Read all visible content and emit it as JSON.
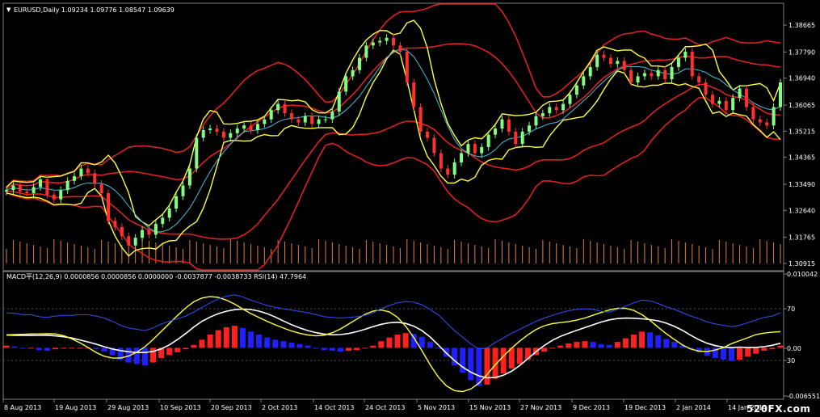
{
  "window": {
    "title": "EURUSD,Daily",
    "ohlc": "1.09234 1.09776 1.08547 1.09639"
  },
  "indicator_label": "MACD平(12,26,9) 0.0000856 0.0000856 0.0000000 -0.0037877 -0.0038733  RSI(14) 47.7964",
  "price_axis": [
    "1.38665",
    "1.37790",
    "1.36940",
    "1.36065",
    "1.35215",
    "1.34365",
    "1.33490",
    "1.32640",
    "1.31765",
    "1.30915"
  ],
  "indicator_axis": [
    "0.010042",
    "70",
    "0.00",
    "30",
    "-0.006551"
  ],
  "date_axis": [
    "8 Aug 2013",
    "19 Aug 2013",
    "29 Aug 2013",
    "10 Sep 2013",
    "20 Sep 2013",
    "2 Oct 2013",
    "14 Oct 2013",
    "24 Oct 2013",
    "5 Nov 2013",
    "15 Nov 2013",
    "27 Nov 2013",
    "9 Dec 2013",
    "19 Dec 2013",
    "2 Jan 2014",
    "14 Jan 2014"
  ],
  "watermark": "520FX.com",
  "colors": {
    "background": "#000000",
    "grid": "#3a3a3a",
    "bollinger": "#e02020",
    "envelope": "#ffff40",
    "moving_average": "#40c0e0",
    "candle_bull": "#80ff80",
    "candle_bear": "#ff3030",
    "volume": "#e08040",
    "macd_up": "#ff2020",
    "macd_down": "#2020ff",
    "rsi": "#3050ff",
    "signal_white": "#ffffff",
    "signal_yellow": "#ffff40"
  },
  "chart_data": [
    {
      "type": "candlestick",
      "title": "EURUSD,Daily",
      "ylim": [
        1.3067,
        1.391
      ],
      "close": [
        1.333,
        1.3345,
        1.3325,
        1.332,
        1.334,
        1.3365,
        1.3315,
        1.33,
        1.333,
        1.336,
        1.3375,
        1.34,
        1.3385,
        1.335,
        1.332,
        1.323,
        1.321,
        1.318,
        1.315,
        1.3175,
        1.32,
        1.3185,
        1.322,
        1.324,
        1.327,
        1.331,
        1.3345,
        1.34,
        1.35,
        1.3525,
        1.353,
        1.352,
        1.35,
        1.3515,
        1.353,
        1.354,
        1.3525,
        1.3545,
        1.356,
        1.359,
        1.361,
        1.358,
        1.356,
        1.355,
        1.357,
        1.3545,
        1.356,
        1.356,
        1.3585,
        1.365,
        1.37,
        1.372,
        1.376,
        1.38,
        1.381,
        1.3815,
        1.3825,
        1.38,
        1.378,
        1.368,
        1.36,
        1.352,
        1.35,
        1.345,
        1.34,
        1.338,
        1.342,
        1.345,
        1.348,
        1.345,
        1.347,
        1.351,
        1.353,
        1.356,
        1.352,
        1.348,
        1.352,
        1.354,
        1.357,
        1.358,
        1.36,
        1.359,
        1.361,
        1.364,
        1.367,
        1.37,
        1.373,
        1.377,
        1.376,
        1.374,
        1.375,
        1.372,
        1.368,
        1.37,
        1.371,
        1.37,
        1.372,
        1.369,
        1.373,
        1.376,
        1.378,
        1.37,
        1.368,
        1.364,
        1.361,
        1.362,
        1.359,
        1.363,
        1.366,
        1.36,
        1.356,
        1.355,
        1.354,
        1.36,
        1.368
      ]
    },
    {
      "type": "bar",
      "title": "MACD(12,26,9)",
      "ylim": [
        -0.006551,
        0.010042
      ],
      "values": [
        0.0003,
        0.0002,
        0.0,
        0.0,
        -0.0003,
        -0.0004,
        -0.0002,
        -0.0001,
        -0.0001,
        0.0,
        0.0,
        -0.0002,
        -0.0005,
        -0.001,
        -0.0016,
        -0.002,
        -0.0022,
        -0.0024,
        -0.002,
        -0.0014,
        -0.001,
        -0.0006,
        -0.0002,
        0.0004,
        0.0011,
        0.0018,
        0.0024,
        0.0028,
        0.003,
        0.0027,
        0.0022,
        0.0018,
        0.0014,
        0.0011,
        0.0009,
        0.0007,
        0.0005,
        0.0003,
        0.0,
        -0.0003,
        -0.0004,
        -0.0005,
        -0.0004,
        -0.0003,
        -0.0001,
        0.0003,
        0.0009,
        0.0014,
        0.0018,
        0.002,
        0.0019,
        0.0015,
        0.0008,
        0.0,
        -0.0012,
        -0.0024,
        -0.0034,
        -0.0044,
        -0.0052,
        -0.005,
        -0.0042,
        -0.0035,
        -0.0028,
        -0.0022,
        -0.0016,
        -0.001,
        -0.0005,
        -0.0001,
        0.0003,
        0.0006,
        0.0008,
        0.0009,
        0.0008,
        0.0005,
        0.0004,
        0.0008,
        0.0013,
        0.0018,
        0.0022,
        0.0021,
        0.0017,
        0.0012,
        0.0008,
        0.0003,
        -0.0002,
        -0.0006,
        -0.0011,
        -0.0014,
        -0.0016,
        -0.0018,
        -0.0016,
        -0.0012,
        -0.0008,
        -0.0004,
        -0.0002,
        0.0003
      ]
    }
  ]
}
